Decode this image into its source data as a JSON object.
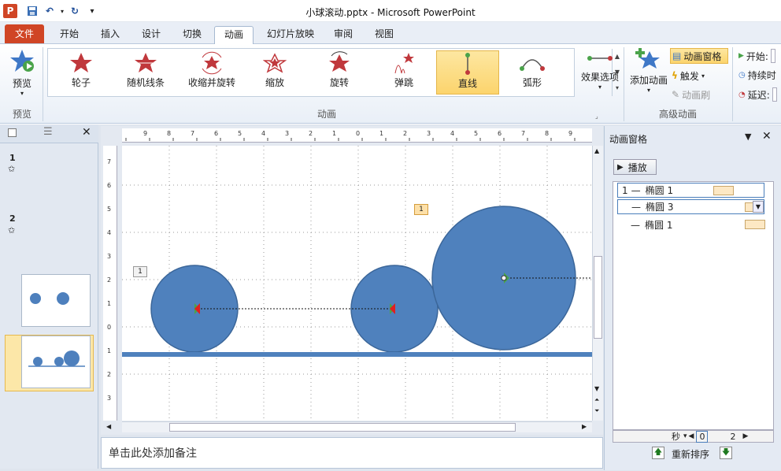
{
  "window": {
    "title": "小球滚动.pptx  -  Microsoft PowerPoint",
    "app_icon": "P"
  },
  "tabs": [
    "文件",
    "开始",
    "插入",
    "设计",
    "切换",
    "动画",
    "幻灯片放映",
    "审阅",
    "视图"
  ],
  "active_tab": "动画",
  "ribbon": {
    "preview_label": "预览",
    "preview_group": "预览",
    "animations": [
      {
        "label": "轮子",
        "icon": "star-icon"
      },
      {
        "label": "随机线条",
        "icon": "star-icon"
      },
      {
        "label": "收缩并旋转",
        "icon": "star-icon"
      },
      {
        "label": "缩放",
        "icon": "star-icon"
      },
      {
        "label": "旋转",
        "icon": "star-icon"
      },
      {
        "label": "弹跳",
        "icon": "star-icon"
      },
      {
        "label": "直线",
        "icon": "line-path-icon"
      },
      {
        "label": "弧形",
        "icon": "arc-path-icon"
      }
    ],
    "selected_animation": "直线",
    "effect_options": "效果选项",
    "animation_group": "动画",
    "add_animation": "添加动画",
    "anim_pane_btn": "动画窗格",
    "trigger": "触发",
    "anim_painter": "动画刷",
    "advanced_group": "高级动画",
    "timing": {
      "start": "开始:",
      "duration": "持续时",
      "delay": "延迟:"
    }
  },
  "slides": [
    {
      "number": "1",
      "star": "✩"
    },
    {
      "number": "2",
      "star": "✩"
    }
  ],
  "ruler": {
    "h": [
      "9",
      "8",
      "7",
      "6",
      "5",
      "4",
      "3",
      "2",
      "1",
      "0",
      "1",
      "2",
      "3",
      "4",
      "5",
      "6",
      "7",
      "8",
      "9"
    ],
    "v": [
      "7",
      "6",
      "5",
      "4",
      "3",
      "2",
      "1",
      "0",
      "1",
      "2",
      "3"
    ]
  },
  "canvas_tags": [
    "1",
    "1"
  ],
  "notes_placeholder": "单击此处添加备注",
  "anim_pane": {
    "title": "动画窗格",
    "play": "播放",
    "items": [
      {
        "num": "1",
        "name": "椭圆 1"
      },
      {
        "num": "",
        "name": "椭圆 3"
      },
      {
        "num": "",
        "name": "椭圆 1"
      }
    ],
    "seconds_label": "秒",
    "timeline": [
      "0",
      "2"
    ],
    "reorder": "重新排序"
  }
}
